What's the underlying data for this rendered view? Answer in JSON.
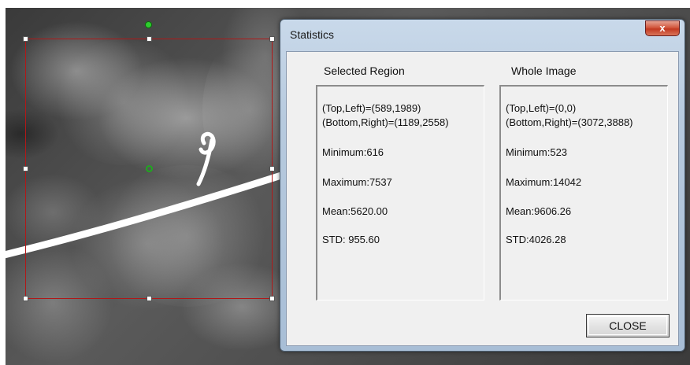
{
  "dialog": {
    "title": "Statistics",
    "close_glyph": "x",
    "close_button": "CLOSE"
  },
  "selected_region": {
    "heading": "Selected Region",
    "top_left": "(Top,Left)=(589,1989)",
    "bottom_right": "(Bottom,Right)=(1189,2558)",
    "minimum": "Minimum:616",
    "maximum": "Maximum:7537",
    "mean": "Mean:5620.00",
    "std": "STD: 955.60"
  },
  "whole_image": {
    "heading": "Whole Image",
    "top_left": "(Top,Left)=(0,0)",
    "bottom_right": "(Bottom,Right)=(3072,3888)",
    "minimum": "Minimum:523",
    "maximum": "Maximum:14042",
    "mean": "Mean:9606.26",
    "std": "STD:4026.28"
  },
  "colors": {
    "roi_border": "#b01818",
    "handle_green": "#2ecc2e"
  }
}
